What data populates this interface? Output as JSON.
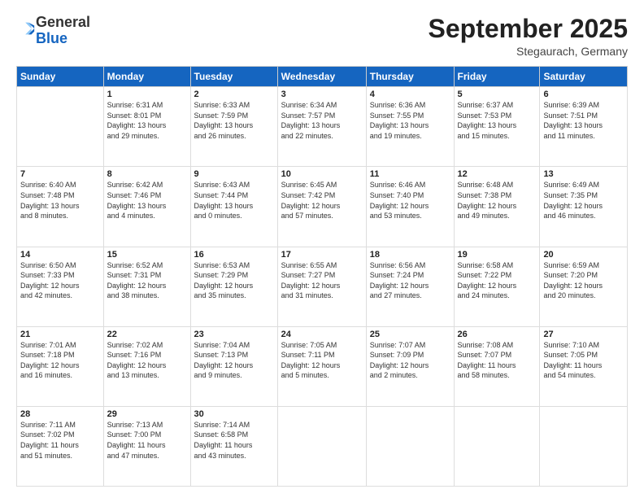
{
  "header": {
    "logo_general": "General",
    "logo_blue": "Blue",
    "month_title": "September 2025",
    "location": "Stegaurach, Germany"
  },
  "days_of_week": [
    "Sunday",
    "Monday",
    "Tuesday",
    "Wednesday",
    "Thursday",
    "Friday",
    "Saturday"
  ],
  "weeks": [
    [
      {
        "day": "",
        "info": ""
      },
      {
        "day": "1",
        "info": "Sunrise: 6:31 AM\nSunset: 8:01 PM\nDaylight: 13 hours\nand 29 minutes."
      },
      {
        "day": "2",
        "info": "Sunrise: 6:33 AM\nSunset: 7:59 PM\nDaylight: 13 hours\nand 26 minutes."
      },
      {
        "day": "3",
        "info": "Sunrise: 6:34 AM\nSunset: 7:57 PM\nDaylight: 13 hours\nand 22 minutes."
      },
      {
        "day": "4",
        "info": "Sunrise: 6:36 AM\nSunset: 7:55 PM\nDaylight: 13 hours\nand 19 minutes."
      },
      {
        "day": "5",
        "info": "Sunrise: 6:37 AM\nSunset: 7:53 PM\nDaylight: 13 hours\nand 15 minutes."
      },
      {
        "day": "6",
        "info": "Sunrise: 6:39 AM\nSunset: 7:51 PM\nDaylight: 13 hours\nand 11 minutes."
      }
    ],
    [
      {
        "day": "7",
        "info": "Sunrise: 6:40 AM\nSunset: 7:48 PM\nDaylight: 13 hours\nand 8 minutes."
      },
      {
        "day": "8",
        "info": "Sunrise: 6:42 AM\nSunset: 7:46 PM\nDaylight: 13 hours\nand 4 minutes."
      },
      {
        "day": "9",
        "info": "Sunrise: 6:43 AM\nSunset: 7:44 PM\nDaylight: 13 hours\nand 0 minutes."
      },
      {
        "day": "10",
        "info": "Sunrise: 6:45 AM\nSunset: 7:42 PM\nDaylight: 12 hours\nand 57 minutes."
      },
      {
        "day": "11",
        "info": "Sunrise: 6:46 AM\nSunset: 7:40 PM\nDaylight: 12 hours\nand 53 minutes."
      },
      {
        "day": "12",
        "info": "Sunrise: 6:48 AM\nSunset: 7:38 PM\nDaylight: 12 hours\nand 49 minutes."
      },
      {
        "day": "13",
        "info": "Sunrise: 6:49 AM\nSunset: 7:35 PM\nDaylight: 12 hours\nand 46 minutes."
      }
    ],
    [
      {
        "day": "14",
        "info": "Sunrise: 6:50 AM\nSunset: 7:33 PM\nDaylight: 12 hours\nand 42 minutes."
      },
      {
        "day": "15",
        "info": "Sunrise: 6:52 AM\nSunset: 7:31 PM\nDaylight: 12 hours\nand 38 minutes."
      },
      {
        "day": "16",
        "info": "Sunrise: 6:53 AM\nSunset: 7:29 PM\nDaylight: 12 hours\nand 35 minutes."
      },
      {
        "day": "17",
        "info": "Sunrise: 6:55 AM\nSunset: 7:27 PM\nDaylight: 12 hours\nand 31 minutes."
      },
      {
        "day": "18",
        "info": "Sunrise: 6:56 AM\nSunset: 7:24 PM\nDaylight: 12 hours\nand 27 minutes."
      },
      {
        "day": "19",
        "info": "Sunrise: 6:58 AM\nSunset: 7:22 PM\nDaylight: 12 hours\nand 24 minutes."
      },
      {
        "day": "20",
        "info": "Sunrise: 6:59 AM\nSunset: 7:20 PM\nDaylight: 12 hours\nand 20 minutes."
      }
    ],
    [
      {
        "day": "21",
        "info": "Sunrise: 7:01 AM\nSunset: 7:18 PM\nDaylight: 12 hours\nand 16 minutes."
      },
      {
        "day": "22",
        "info": "Sunrise: 7:02 AM\nSunset: 7:16 PM\nDaylight: 12 hours\nand 13 minutes."
      },
      {
        "day": "23",
        "info": "Sunrise: 7:04 AM\nSunset: 7:13 PM\nDaylight: 12 hours\nand 9 minutes."
      },
      {
        "day": "24",
        "info": "Sunrise: 7:05 AM\nSunset: 7:11 PM\nDaylight: 12 hours\nand 5 minutes."
      },
      {
        "day": "25",
        "info": "Sunrise: 7:07 AM\nSunset: 7:09 PM\nDaylight: 12 hours\nand 2 minutes."
      },
      {
        "day": "26",
        "info": "Sunrise: 7:08 AM\nSunset: 7:07 PM\nDaylight: 11 hours\nand 58 minutes."
      },
      {
        "day": "27",
        "info": "Sunrise: 7:10 AM\nSunset: 7:05 PM\nDaylight: 11 hours\nand 54 minutes."
      }
    ],
    [
      {
        "day": "28",
        "info": "Sunrise: 7:11 AM\nSunset: 7:02 PM\nDaylight: 11 hours\nand 51 minutes."
      },
      {
        "day": "29",
        "info": "Sunrise: 7:13 AM\nSunset: 7:00 PM\nDaylight: 11 hours\nand 47 minutes."
      },
      {
        "day": "30",
        "info": "Sunrise: 7:14 AM\nSunset: 6:58 PM\nDaylight: 11 hours\nand 43 minutes."
      },
      {
        "day": "",
        "info": ""
      },
      {
        "day": "",
        "info": ""
      },
      {
        "day": "",
        "info": ""
      },
      {
        "day": "",
        "info": ""
      }
    ]
  ]
}
